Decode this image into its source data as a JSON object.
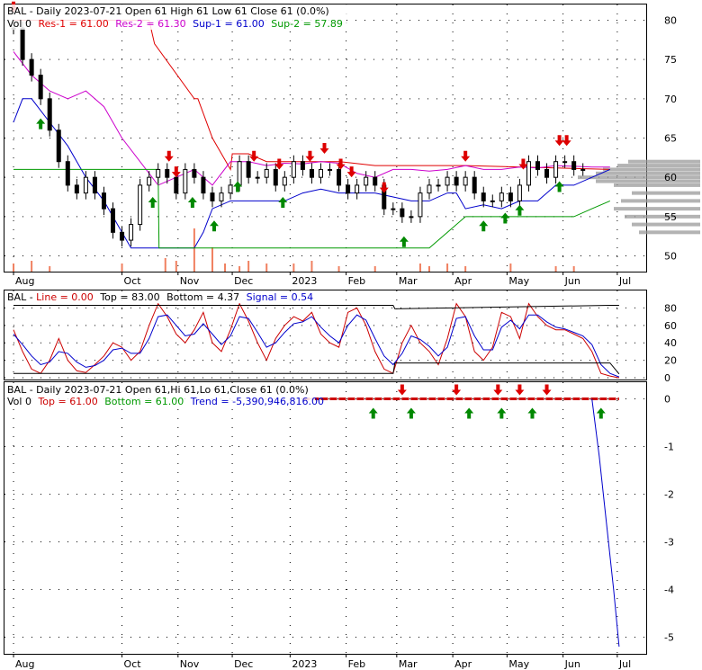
{
  "chart_data": [
    {
      "type": "line",
      "panel": "price",
      "title": "BAL - Daily 2023-07-21 Open 61  High 61  Low 61  Close 61 (0.0%)",
      "legend_items": [
        {
          "label": "Vol 0",
          "color": "#000000"
        },
        {
          "label": "Res-1 = 61.00",
          "color": "#e00000"
        },
        {
          "label": "Res-2 = 61.30",
          "color": "#cc00cc"
        },
        {
          "label": "Sup-1 = 61.00",
          "color": "#0000cc"
        },
        {
          "label": "Sup-2 = 57.89",
          "color": "#009900"
        }
      ],
      "ylim": [
        48,
        82
      ],
      "y_ticks": [
        80,
        75,
        70,
        65,
        60,
        55,
        50
      ],
      "x_ticks": [
        "Aug",
        "Oct",
        "Nov",
        "Dec",
        "2023",
        "Feb",
        "Mar",
        "Apr",
        "May",
        "Jun",
        "Jul"
      ],
      "x_tick_days": [
        0,
        60,
        91,
        121,
        153,
        184,
        212,
        243,
        273,
        304,
        334
      ],
      "x_range_days": [
        -5,
        350
      ],
      "series": [
        {
          "name": "Close",
          "color": "#000000",
          "x": [
            0,
            5,
            10,
            15,
            20,
            25,
            30,
            35,
            40,
            45,
            50,
            55,
            60,
            65,
            70,
            75,
            80,
            85,
            90,
            95,
            100,
            105,
            110,
            115,
            120,
            125,
            130,
            135,
            140,
            145,
            150,
            155,
            160,
            165,
            170,
            175,
            180,
            185,
            190,
            195,
            200,
            205,
            210,
            215,
            220,
            225,
            230,
            235,
            240,
            245,
            250,
            255,
            260,
            265,
            270,
            275,
            280,
            285,
            290,
            295,
            300,
            305,
            310,
            315
          ],
          "y": [
            79,
            75,
            73,
            70,
            66,
            62,
            59,
            58,
            60,
            58,
            56,
            53,
            52,
            54,
            59,
            60,
            61,
            60,
            58,
            61,
            60,
            58,
            57,
            58,
            59,
            62,
            60,
            60,
            61,
            59,
            60,
            62,
            61,
            60,
            61,
            61,
            59,
            58,
            59,
            60,
            59,
            56,
            56,
            55,
            55,
            58,
            59,
            59,
            60,
            59,
            60,
            58,
            57,
            57,
            58,
            57,
            59,
            62,
            61,
            60,
            62,
            62,
            61,
            61
          ]
        },
        {
          "name": "Res-1",
          "color": "#e00000",
          "x": [
            0,
            75,
            78,
            100,
            102,
            110,
            120,
            121,
            130,
            140,
            180,
            200,
            250,
            300,
            330
          ],
          "y": [
            80,
            80,
            77,
            70,
            70,
            65,
            61,
            63,
            63,
            62,
            62,
            61.5,
            61.5,
            61.2,
            61
          ]
        },
        {
          "name": "Res-2",
          "color": "#cc00cc",
          "x": [
            0,
            10,
            20,
            30,
            40,
            50,
            60,
            70,
            75,
            80,
            90,
            100,
            110,
            120,
            130,
            140,
            150,
            160,
            170,
            180,
            190,
            200,
            210,
            220,
            230,
            240,
            250,
            260,
            270,
            280,
            290,
            300,
            310,
            320,
            330
          ],
          "y": [
            76,
            73,
            71,
            70,
            71,
            69,
            65,
            62,
            60.5,
            59,
            60,
            61,
            59,
            62,
            62,
            61.5,
            61.8,
            61.7,
            62,
            61.8,
            60.5,
            60,
            61,
            61,
            60.8,
            61,
            61.5,
            61,
            61,
            61.3,
            61.2,
            61.5,
            61.4,
            61.3,
            61.3
          ]
        },
        {
          "name": "Sup-1",
          "color": "#0000cc",
          "x": [
            0,
            5,
            10,
            20,
            30,
            40,
            50,
            55,
            60,
            65,
            67,
            70,
            75,
            80,
            85,
            90,
            95,
            100,
            105,
            110,
            120,
            130,
            140,
            150,
            160,
            170,
            180,
            190,
            200,
            210,
            220,
            230,
            240,
            245,
            250,
            260,
            270,
            280,
            290,
            300,
            310,
            320,
            330
          ],
          "y": [
            67,
            70,
            70,
            67,
            64,
            60,
            57,
            55,
            53,
            51,
            51,
            51,
            51,
            51,
            51,
            51,
            51,
            51,
            53,
            56,
            57,
            57,
            57,
            57,
            58,
            58.5,
            58,
            58,
            58,
            57.5,
            57,
            57,
            58,
            58,
            56,
            56.5,
            56,
            57,
            57,
            59,
            59,
            60,
            61
          ]
        },
        {
          "name": "Sup-2",
          "color": "#009900",
          "x": [
            0,
            15,
            15.5,
            30,
            80,
            80.5,
            150,
            151,
            180,
            181,
            212,
            214,
            230,
            250,
            260,
            280,
            300,
            310,
            320,
            330
          ],
          "y": [
            61,
            61,
            61,
            61,
            61,
            51,
            51,
            51,
            51,
            51,
            51,
            51,
            51,
            55,
            55,
            55,
            55,
            55,
            56,
            57
          ]
        }
      ],
      "volume": {
        "x": [
          0,
          10,
          20,
          60,
          84,
          90,
          100,
          110,
          117,
          125,
          130,
          140,
          155,
          165,
          180,
          200,
          225,
          230,
          240,
          250,
          275,
          300,
          310
        ],
        "values": [
          3,
          4,
          2,
          3,
          5,
          4,
          16,
          9,
          3,
          2,
          4,
          3,
          3,
          4,
          2,
          2,
          3,
          2,
          3,
          2,
          3,
          2,
          2
        ],
        "color": "#f08060"
      },
      "sell_signals_days": [
        0,
        86,
        90,
        133,
        147,
        164,
        172,
        181,
        187,
        205,
        250,
        282,
        302,
        306
      ],
      "buy_signals_days": [
        15,
        77,
        99,
        111,
        124,
        149,
        216,
        260,
        272,
        280,
        302
      ]
    },
    {
      "type": "line",
      "panel": "oscillator",
      "title": "BAL - Line = 0.00, Top = 83.00, Bottom = 4.37, Signal = 0.54",
      "legend_items": [
        {
          "label": "BAL - ",
          "color": "#000000"
        },
        {
          "label": "Line = 0.00",
          "color": "#cc0000"
        },
        {
          "label": "Top = 83.00",
          "color": "#000000"
        },
        {
          "label": "Bottom = 4.37",
          "color": "#000000"
        },
        {
          "label": "Signal = 0.54",
          "color": "#0000cc"
        }
      ],
      "ylim": [
        -2,
        100
      ],
      "y_ticks": [
        80,
        60,
        40,
        20,
        0
      ],
      "series": [
        {
          "name": "Line",
          "color": "#cc0000",
          "x": [
            0,
            5,
            10,
            15,
            20,
            25,
            30,
            35,
            40,
            45,
            50,
            55,
            60,
            65,
            70,
            75,
            80,
            85,
            90,
            95,
            100,
            105,
            110,
            115,
            120,
            125,
            130,
            135,
            140,
            145,
            150,
            155,
            160,
            165,
            170,
            175,
            180,
            185,
            190,
            195,
            200,
            205,
            210,
            215,
            220,
            225,
            230,
            235,
            240,
            245,
            250,
            255,
            260,
            265,
            270,
            275,
            280,
            285,
            290,
            295,
            300,
            305,
            310,
            315,
            320,
            325,
            330,
            335
          ],
          "y": [
            55,
            30,
            10,
            5,
            20,
            45,
            20,
            8,
            6,
            15,
            25,
            40,
            35,
            20,
            30,
            60,
            85,
            70,
            50,
            40,
            55,
            75,
            40,
            30,
            55,
            85,
            65,
            40,
            20,
            45,
            60,
            70,
            65,
            75,
            50,
            40,
            35,
            75,
            80,
            60,
            30,
            10,
            5,
            40,
            60,
            40,
            30,
            15,
            45,
            85,
            70,
            30,
            20,
            35,
            75,
            70,
            45,
            85,
            70,
            60,
            55,
            55,
            50,
            45,
            30,
            5,
            2,
            0
          ]
        },
        {
          "name": "Signal",
          "color": "#0000cc",
          "x": [
            0,
            5,
            10,
            15,
            20,
            25,
            30,
            35,
            40,
            45,
            50,
            55,
            60,
            65,
            70,
            75,
            80,
            85,
            90,
            95,
            100,
            105,
            110,
            115,
            120,
            125,
            130,
            135,
            140,
            145,
            150,
            155,
            160,
            165,
            170,
            175,
            180,
            185,
            190,
            195,
            200,
            205,
            210,
            215,
            220,
            225,
            230,
            235,
            240,
            245,
            250,
            255,
            260,
            265,
            270,
            275,
            280,
            285,
            290,
            295,
            300,
            305,
            310,
            315,
            320,
            325,
            330,
            335
          ],
          "y": [
            50,
            38,
            25,
            15,
            18,
            30,
            28,
            18,
            12,
            14,
            20,
            32,
            34,
            28,
            28,
            45,
            70,
            72,
            60,
            48,
            50,
            62,
            50,
            38,
            48,
            70,
            68,
            52,
            35,
            40,
            52,
            62,
            64,
            70,
            58,
            48,
            40,
            60,
            72,
            66,
            45,
            25,
            15,
            28,
            48,
            44,
            36,
            25,
            35,
            68,
            70,
            48,
            32,
            32,
            58,
            66,
            56,
            72,
            72,
            64,
            58,
            56,
            52,
            48,
            38,
            15,
            5,
            1
          ]
        },
        {
          "name": "Top",
          "color": "#000000",
          "x": [
            0,
            75,
            76,
            210,
            211,
            330,
            335
          ],
          "y": [
            83,
            83,
            83,
            83,
            79,
            83,
            83
          ]
        },
        {
          "name": "Bottom",
          "color": "#000000",
          "x": [
            0,
            210,
            211,
            330,
            335
          ],
          "y": [
            5,
            5,
            17,
            17,
            4.37
          ]
        }
      ]
    },
    {
      "type": "line",
      "panel": "trend",
      "title": "BAL - Daily 2023-07-21 Open 61,Hi 61,Lo 61,Close 61 (0.0%)",
      "legend_items": [
        {
          "label": "Vol 0",
          "color": "#000000"
        },
        {
          "label": "Top = 61.00",
          "color": "#cc0000"
        },
        {
          "label": "Bottom = 61.00",
          "color": "#009900"
        },
        {
          "label": "Trend = -5,390,946,816.00",
          "color": "#0000cc"
        }
      ],
      "ylim": [
        -5.35,
        0.35
      ],
      "y_ticks": [
        0,
        -1,
        -2,
        -3,
        -4,
        -5
      ],
      "y_tick_labels": [
        "0",
        "-1",
        "-2",
        "-3",
        "-4",
        "-5"
      ],
      "series": [
        {
          "name": "Top",
          "color": "#cc0000",
          "x": [
            160,
            335
          ],
          "y": [
            0,
            0
          ]
        },
        {
          "name": "Trend",
          "color": "#0000cc",
          "x": [
            320,
            324,
            328,
            332,
            335
          ],
          "y": [
            0,
            -1.2,
            -2.6,
            -4.0,
            -5.2
          ]
        }
      ],
      "sell_signals_days": [
        215,
        245,
        268,
        280,
        295
      ],
      "buy_signals_days": [
        199,
        220,
        252,
        270,
        287,
        325
      ]
    }
  ],
  "x_axis_labels": [
    "Aug",
    "Oct",
    "Nov",
    "Dec",
    "2023",
    "Feb",
    "Mar",
    "Apr",
    "May",
    "Jun",
    "Jul"
  ]
}
